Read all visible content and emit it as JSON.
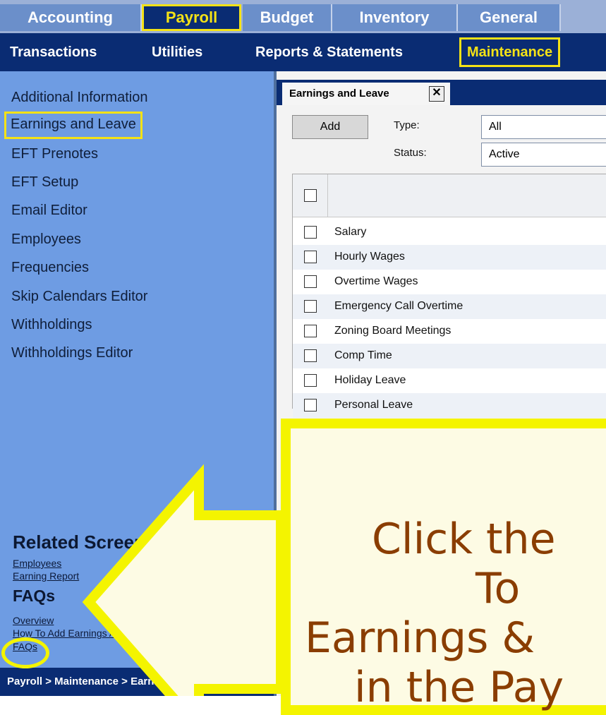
{
  "top_tabs": [
    {
      "label": "Accounting",
      "active": false
    },
    {
      "label": "Payroll",
      "active": true
    },
    {
      "label": "Budget",
      "active": false
    },
    {
      "label": "Inventory",
      "active": false
    },
    {
      "label": "General",
      "active": false
    }
  ],
  "nav": [
    {
      "label": "Transactions",
      "active": false
    },
    {
      "label": "Utilities",
      "active": false
    },
    {
      "label": "Reports & Statements",
      "active": false
    },
    {
      "label": "Maintenance",
      "active": true
    }
  ],
  "sidebar": {
    "items": [
      {
        "label": "Additional Information"
      },
      {
        "label": "Earnings and Leave",
        "active": true
      },
      {
        "label": "EFT Prenotes"
      },
      {
        "label": "EFT Setup"
      },
      {
        "label": "Email Editor"
      },
      {
        "label": "Employees"
      },
      {
        "label": "Frequencies"
      },
      {
        "label": "Skip Calendars Editor"
      },
      {
        "label": "Withholdings"
      },
      {
        "label": "Withholdings Editor"
      }
    ],
    "related_title": "Related Screens",
    "related_links": [
      "Employees",
      "Earning Report"
    ],
    "faqs_title": "FAQs",
    "faq_links": [
      "Overview",
      "How To Add Earnings A...",
      "FAQs"
    ]
  },
  "breadcrumb": "Payroll > Maintenance > Earnings and Leave",
  "content": {
    "tab_label": "Earnings and Leave",
    "tab_close": "✕",
    "add_label": "Add",
    "type_label": "Type:",
    "type_value": "All",
    "status_label": "Status:",
    "status_value": "Active",
    "rows": [
      "Salary",
      "Hourly Wages",
      "Overtime Wages",
      "Emergency Call Overtime",
      "Zoning Board Meetings",
      "Comp Time",
      "Holiday Leave",
      "Personal Leave"
    ]
  },
  "callout": {
    "lines": [
      "Click the",
      "To",
      "Earnings &",
      "in the Pay"
    ],
    "text_color": "#8a3d00",
    "border_color": "#f4f400"
  },
  "colors": {
    "nav_bg": "#0a2c73",
    "sidebar_bg": "#6e9ce3",
    "highlight": "#f4e216"
  }
}
